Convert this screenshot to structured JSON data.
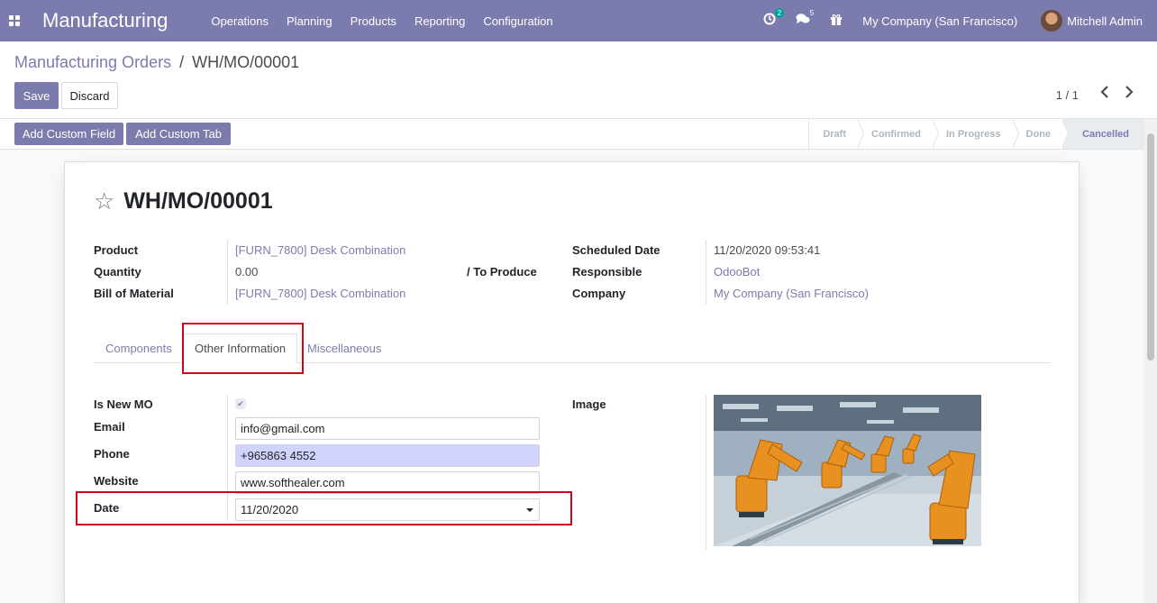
{
  "navbar": {
    "app_name": "Manufacturing",
    "menu": [
      "Operations",
      "Planning",
      "Products",
      "Reporting",
      "Configuration"
    ],
    "activity_count": "2",
    "messages_count": "5",
    "company": "My Company (San Francisco)",
    "user": "Mitchell Admin"
  },
  "breadcrumb": {
    "parent": "Manufacturing Orders",
    "separator": "/",
    "current": "WH/MO/00001"
  },
  "actions": {
    "save": "Save",
    "discard": "Discard"
  },
  "pager": {
    "value": "1 / 1"
  },
  "custom_buttons": {
    "add_field": "Add Custom Field",
    "add_tab": "Add Custom Tab"
  },
  "stages": [
    "Draft",
    "Confirmed",
    "In Progress",
    "Done",
    "Cancelled"
  ],
  "active_stage": "Cancelled",
  "record": {
    "name": "WH/MO/00001",
    "product_label": "Product",
    "product": "[FURN_7800] Desk Combination",
    "quantity_label": "Quantity",
    "quantity": "0.00",
    "to_produce": "/ To Produce",
    "bom_label": "Bill of Material",
    "bom": "[FURN_7800] Desk Combination",
    "scheduled_label": "Scheduled Date",
    "scheduled": "11/20/2020 09:53:41",
    "responsible_label": "Responsible",
    "responsible": "OdooBot",
    "company_label": "Company",
    "company": "My Company (San Francisco)"
  },
  "tabs": [
    "Components",
    "Other Information",
    "Miscellaneous"
  ],
  "active_tab": "Other Information",
  "other_info": {
    "is_new_mo_label": "Is New MO",
    "is_new_mo": true,
    "email_label": "Email",
    "email": "info@gmail.com",
    "phone_label": "Phone",
    "phone": "+965863 4552",
    "website_label": "Website",
    "website": "www.softhealer.com",
    "date_label": "Date",
    "date": "11/20/2020",
    "image_label": "Image"
  },
  "colors": {
    "brand": "#7c7bad",
    "highlight": "#d2d2ff",
    "annotation": "#d0021b"
  }
}
